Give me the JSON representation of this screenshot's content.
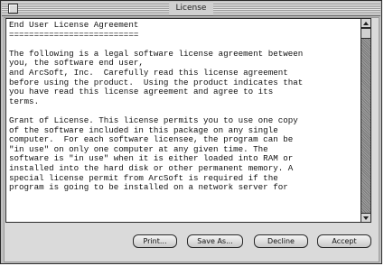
{
  "window": {
    "title": "License"
  },
  "license": {
    "text": "End User License Agreement\n==========================\n\nThe following is a legal software license agreement between\nyou, the software end user,\nand ArcSoft, Inc.  Carefully read this license agreement\nbefore using the product.  Using the product indicates that\nyou have read this license agreement and agree to its\nterms.\n\nGrant of License. This license permits you to use one copy\nof the software included in this package on any single\ncomputer.  For each software licensee, the program can be\n\"in use\" on only one computer at any given time. The\nsoftware is \"in use\" when it is either loaded into RAM or\ninstalled into the hard disk or other permanent memory. A\nspecial license permit from ArcSoft is required if the\nprogram is going to be installed on a network server for"
  },
  "buttons": {
    "print": "Print...",
    "save_as": "Save As...",
    "decline": "Decline",
    "accept": "Accept"
  },
  "icons": {
    "close": "close-box-icon",
    "scroll_up": "scroll-up-arrow-icon",
    "scroll_down": "scroll-down-arrow-icon"
  }
}
